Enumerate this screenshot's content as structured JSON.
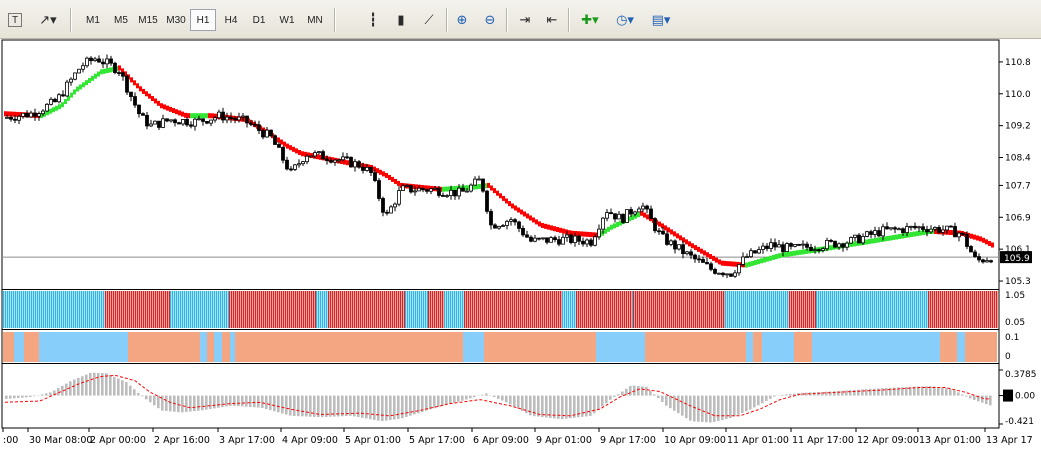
{
  "toolbar": {
    "timeframes": [
      "M1",
      "M5",
      "M15",
      "M30",
      "H1",
      "H4",
      "D1",
      "W1",
      "MN"
    ],
    "active_timeframe": "H1",
    "icons": [
      "text-tool-icon",
      "arrow-tool-icon",
      "bar-chart-icon",
      "candlestick-chart-icon",
      "line-chart-icon",
      "zoom-in-icon",
      "zoom-out-icon",
      "auto-scroll-icon",
      "chart-shift-icon",
      "add-indicator-icon",
      "period-clock-icon",
      "template-icon"
    ]
  },
  "chart_data": [
    {
      "type": "candlestick",
      "panel": "price",
      "y_ticks": [
        "110.8",
        "110.0",
        "109.2",
        "108.4",
        "107.7",
        "106.9",
        "106.1",
        "105.3"
      ],
      "ylim": [
        105.1,
        111.35
      ],
      "current_price_label": "105.9",
      "current_price": 105.9,
      "overlay": {
        "name": "",
        "colors": {
          "up": "#33e633",
          "down": "#ff0000"
        },
        "trend_segments": [
          {
            "dir": "up",
            "from": "1 Apr",
            "to": "2 Apr 04:00"
          },
          {
            "dir": "down",
            "from": "2 Apr 04:00",
            "to": "6 Apr 09:00"
          },
          {
            "dir": "up",
            "from": "6 Apr 05:00",
            "to": "6 Apr 10:00"
          },
          {
            "dir": "down",
            "from": "6 Apr 10:00",
            "to": "9 Apr 07:00"
          },
          {
            "dir": "up",
            "from": "9 Apr 07:00",
            "to": "9 Apr 22:00"
          },
          {
            "dir": "down",
            "from": "9 Apr 22:00",
            "to": "11 Apr 01:00"
          },
          {
            "dir": "up",
            "from": "11 Apr 01:00",
            "to": "13 Apr 02:00"
          },
          {
            "dir": "down",
            "from": "13 Apr 02:00",
            "to": "13 Apr 17:00"
          }
        ]
      },
      "trend_path": [
        [
          3,
          109.5
        ],
        [
          40,
          109.45
        ],
        [
          60,
          109.7
        ],
        [
          75,
          110.1
        ],
        [
          100,
          110.55
        ],
        [
          118,
          110.65
        ],
        [
          140,
          110.1
        ],
        [
          160,
          109.7
        ],
        [
          185,
          109.45
        ],
        [
          210,
          109.45
        ],
        [
          245,
          109.35
        ],
        [
          268,
          109.0
        ],
        [
          285,
          108.7
        ],
        [
          300,
          108.5
        ],
        [
          330,
          108.35
        ],
        [
          370,
          108.15
        ],
        [
          385,
          107.95
        ],
        [
          400,
          107.7
        ],
        [
          440,
          107.6
        ],
        [
          470,
          107.65
        ],
        [
          487,
          107.7
        ],
        [
          510,
          107.2
        ],
        [
          540,
          106.7
        ],
        [
          570,
          106.5
        ],
        [
          598,
          106.45
        ],
        [
          610,
          106.65
        ],
        [
          640,
          107.0
        ],
        [
          660,
          106.7
        ],
        [
          690,
          106.2
        ],
        [
          720,
          105.75
        ],
        [
          745,
          105.7
        ],
        [
          780,
          105.95
        ],
        [
          820,
          106.1
        ],
        [
          870,
          106.3
        ],
        [
          930,
          106.55
        ],
        [
          960,
          106.5
        ],
        [
          980,
          106.35
        ],
        [
          995,
          106.15
        ]
      ],
      "price_path": [
        [
          3,
          109.4
        ],
        [
          30,
          109.5
        ],
        [
          55,
          109.8
        ],
        [
          80,
          110.7
        ],
        [
          95,
          110.9
        ],
        [
          118,
          110.6
        ],
        [
          140,
          109.4
        ],
        [
          150,
          109.2
        ],
        [
          170,
          109.35
        ],
        [
          195,
          109.3
        ],
        [
          220,
          109.45
        ],
        [
          245,
          109.3
        ],
        [
          270,
          108.9
        ],
        [
          290,
          108.0
        ],
        [
          305,
          108.5
        ],
        [
          330,
          108.4
        ],
        [
          360,
          108.2
        ],
        [
          370,
          108.0
        ],
        [
          385,
          106.9
        ],
        [
          400,
          107.6
        ],
        [
          430,
          107.6
        ],
        [
          460,
          107.5
        ],
        [
          480,
          107.85
        ],
        [
          490,
          106.7
        ],
        [
          510,
          106.85
        ],
        [
          530,
          106.3
        ],
        [
          560,
          106.35
        ],
        [
          590,
          106.3
        ],
        [
          605,
          107.1
        ],
        [
          620,
          106.85
        ],
        [
          640,
          107.25
        ],
        [
          660,
          106.4
        ],
        [
          690,
          105.9
        ],
        [
          710,
          105.6
        ],
        [
          730,
          105.5
        ],
        [
          745,
          105.9
        ],
        [
          770,
          106.2
        ],
        [
          790,
          106.1
        ],
        [
          820,
          106.2
        ],
        [
          850,
          106.3
        ],
        [
          880,
          106.55
        ],
        [
          920,
          106.65
        ],
        [
          940,
          106.6
        ],
        [
          960,
          106.5
        ],
        [
          975,
          105.8
        ],
        [
          990,
          105.9
        ]
      ],
      "x_labels": [
        ":00",
        "30 Mar 08:00",
        "2 Apr 00:00",
        "2 Apr 16:00",
        "3 Apr 17:00",
        "4 Apr 09:00",
        "5 Apr 01:00",
        "5 Apr 17:00",
        "6 Apr 09:00",
        "9 Apr 01:00",
        "9 Apr 17:00",
        "10 Apr 09:00",
        "11 Apr 01:00",
        "11 Apr 17:00",
        "12 Apr 09:00",
        "13 Apr 01:00",
        "13 Apr 17"
      ]
    },
    {
      "type": "histogram",
      "panel": "trend-bars",
      "y_ticks": [
        "1.05",
        "0.05"
      ],
      "colors": {
        "up": "#2fb6e8",
        "down": "#dc2121"
      },
      "blocks": [
        {
          "dir": "up",
          "from": 3,
          "to": 105
        },
        {
          "dir": "down",
          "from": 105,
          "to": 170
        },
        {
          "dir": "up",
          "from": 170,
          "to": 229
        },
        {
          "dir": "down",
          "from": 229,
          "to": 316
        },
        {
          "dir": "up",
          "from": 316,
          "to": 328
        },
        {
          "dir": "down",
          "from": 328,
          "to": 405
        },
        {
          "dir": "up",
          "from": 405,
          "to": 428
        },
        {
          "dir": "down",
          "from": 428,
          "to": 444
        },
        {
          "dir": "up",
          "from": 444,
          "to": 464
        },
        {
          "dir": "down",
          "from": 464,
          "to": 562
        },
        {
          "dir": "up",
          "from": 562,
          "to": 576
        },
        {
          "dir": "down",
          "from": 576,
          "to": 632
        },
        {
          "dir": "up",
          "from": 632,
          "to": 633
        },
        {
          "dir": "down",
          "from": 633,
          "to": 725
        },
        {
          "dir": "up",
          "from": 725,
          "to": 789
        },
        {
          "dir": "down",
          "from": 789,
          "to": 816
        },
        {
          "dir": "up",
          "from": 816,
          "to": 928
        },
        {
          "dir": "down",
          "from": 928,
          "to": 997
        }
      ]
    },
    {
      "type": "histogram",
      "panel": "state-bars",
      "y_ticks": [
        "0.1",
        "0"
      ],
      "colors": {
        "up": "#87cefa",
        "down": "#f4a582"
      },
      "blocks": [
        {
          "dir": "down",
          "from": 3,
          "to": 14
        },
        {
          "dir": "up",
          "from": 14,
          "to": 24
        },
        {
          "dir": "down",
          "from": 24,
          "to": 39
        },
        {
          "dir": "up",
          "from": 39,
          "to": 128
        },
        {
          "dir": "down",
          "from": 128,
          "to": 200
        },
        {
          "dir": "up",
          "from": 200,
          "to": 207
        },
        {
          "dir": "down",
          "from": 207,
          "to": 214
        },
        {
          "dir": "up",
          "from": 214,
          "to": 222
        },
        {
          "dir": "down",
          "from": 222,
          "to": 230
        },
        {
          "dir": "up",
          "from": 230,
          "to": 235
        },
        {
          "dir": "down",
          "from": 235,
          "to": 463
        },
        {
          "dir": "up",
          "from": 463,
          "to": 484
        },
        {
          "dir": "down",
          "from": 484,
          "to": 596
        },
        {
          "dir": "up",
          "from": 596,
          "to": 645
        },
        {
          "dir": "down",
          "from": 645,
          "to": 746
        },
        {
          "dir": "up",
          "from": 746,
          "to": 753
        },
        {
          "dir": "down",
          "from": 753,
          "to": 762
        },
        {
          "dir": "up",
          "from": 762,
          "to": 794
        },
        {
          "dir": "down",
          "from": 794,
          "to": 812
        },
        {
          "dir": "up",
          "from": 812,
          "to": 940
        },
        {
          "dir": "down",
          "from": 940,
          "to": 957
        },
        {
          "dir": "up",
          "from": 957,
          "to": 965
        },
        {
          "dir": "down",
          "from": 965,
          "to": 997
        }
      ]
    },
    {
      "type": "oscillator",
      "panel": "osc",
      "y_ticks": [
        "0.3785",
        "0.00",
        "-0.421"
      ],
      "ylim": [
        -0.421,
        0.3785
      ],
      "hist_color": "#bcbcbc",
      "signal_color": "#ff0000",
      "histogram": [
        [
          5,
          -0.05
        ],
        [
          30,
          -0.02
        ],
        [
          50,
          0.05
        ],
        [
          70,
          0.22
        ],
        [
          90,
          0.34
        ],
        [
          105,
          0.33
        ],
        [
          125,
          0.2
        ],
        [
          140,
          0.0
        ],
        [
          160,
          -0.22
        ],
        [
          180,
          -0.25
        ],
        [
          200,
          -0.22
        ],
        [
          230,
          -0.15
        ],
        [
          260,
          -0.18
        ],
        [
          290,
          -0.3
        ],
        [
          320,
          -0.32
        ],
        [
          350,
          -0.3
        ],
        [
          380,
          -0.38
        ],
        [
          400,
          -0.34
        ],
        [
          430,
          -0.2
        ],
        [
          460,
          -0.08
        ],
        [
          485,
          0.03
        ],
        [
          505,
          -0.1
        ],
        [
          530,
          -0.3
        ],
        [
          560,
          -0.35
        ],
        [
          590,
          -0.3
        ],
        [
          610,
          -0.05
        ],
        [
          630,
          0.15
        ],
        [
          645,
          0.13
        ],
        [
          665,
          -0.15
        ],
        [
          690,
          -0.38
        ],
        [
          710,
          -0.4
        ],
        [
          730,
          -0.33
        ],
        [
          750,
          -0.2
        ],
        [
          775,
          0.0
        ],
        [
          800,
          0.04
        ],
        [
          830,
          0.06
        ],
        [
          870,
          0.1
        ],
        [
          910,
          0.13
        ],
        [
          930,
          0.14
        ],
        [
          950,
          0.1
        ],
        [
          970,
          -0.05
        ],
        [
          990,
          -0.15
        ]
      ],
      "signal": [
        [
          3,
          -0.1
        ],
        [
          40,
          -0.08
        ],
        [
          60,
          0.05
        ],
        [
          80,
          0.18
        ],
        [
          100,
          0.28
        ],
        [
          115,
          0.3
        ],
        [
          135,
          0.22
        ],
        [
          150,
          0.05
        ],
        [
          170,
          -0.1
        ],
        [
          190,
          -0.18
        ],
        [
          230,
          -0.12
        ],
        [
          260,
          -0.1
        ],
        [
          290,
          -0.2
        ],
        [
          320,
          -0.28
        ],
        [
          360,
          -0.26
        ],
        [
          390,
          -0.3
        ],
        [
          420,
          -0.22
        ],
        [
          450,
          -0.12
        ],
        [
          480,
          -0.06
        ],
        [
          510,
          -0.15
        ],
        [
          540,
          -0.28
        ],
        [
          570,
          -0.3
        ],
        [
          600,
          -0.2
        ],
        [
          620,
          -0.02
        ],
        [
          640,
          0.1
        ],
        [
          660,
          0.06
        ],
        [
          690,
          -0.15
        ],
        [
          715,
          -0.3
        ],
        [
          740,
          -0.3
        ],
        [
          760,
          -0.2
        ],
        [
          780,
          -0.06
        ],
        [
          800,
          0.02
        ],
        [
          840,
          0.05
        ],
        [
          880,
          0.08
        ],
        [
          920,
          0.12
        ],
        [
          945,
          0.12
        ],
        [
          965,
          0.05
        ],
        [
          985,
          -0.05
        ]
      ]
    }
  ]
}
